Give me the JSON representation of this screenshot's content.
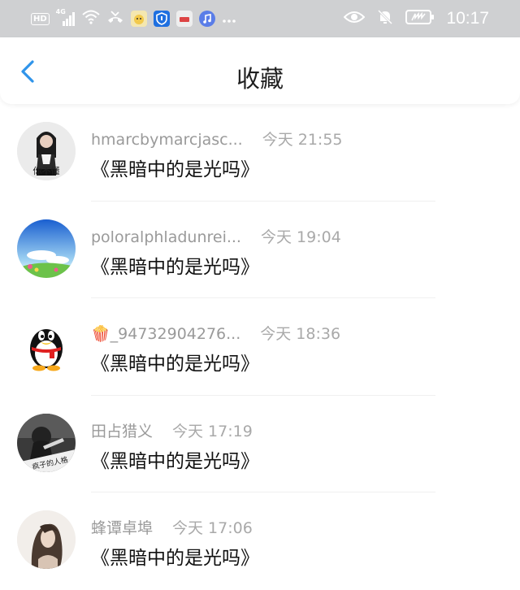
{
  "status_bar": {
    "hd": "HD",
    "network": "4G",
    "time": "10:17"
  },
  "header": {
    "title": "收藏"
  },
  "favorites": [
    {
      "name": "hmarcbymarcjasc...",
      "time": "今天 21:55",
      "content": "《黑暗中的是光吗》",
      "avatar_caption": "你不懂"
    },
    {
      "name": "poloralphladunrei...",
      "time": "今天 19:04",
      "content": "《黑暗中的是光吗》"
    },
    {
      "name": "🍿_94732904276...",
      "time": "今天 18:36",
      "content": "《黑暗中的是光吗》"
    },
    {
      "name": "田占猎义",
      "time": "今天 17:19",
      "content": "《黑暗中的是光吗》",
      "avatar_caption": "疯子的人格"
    },
    {
      "name": "蜂谭卓埠",
      "time": "今天 17:06",
      "content": "《黑暗中的是光吗》"
    }
  ],
  "colors": {
    "accent": "#2f94ea",
    "status_bar_bg": "#cfd0d2",
    "meta_text": "#9a9a9a"
  }
}
